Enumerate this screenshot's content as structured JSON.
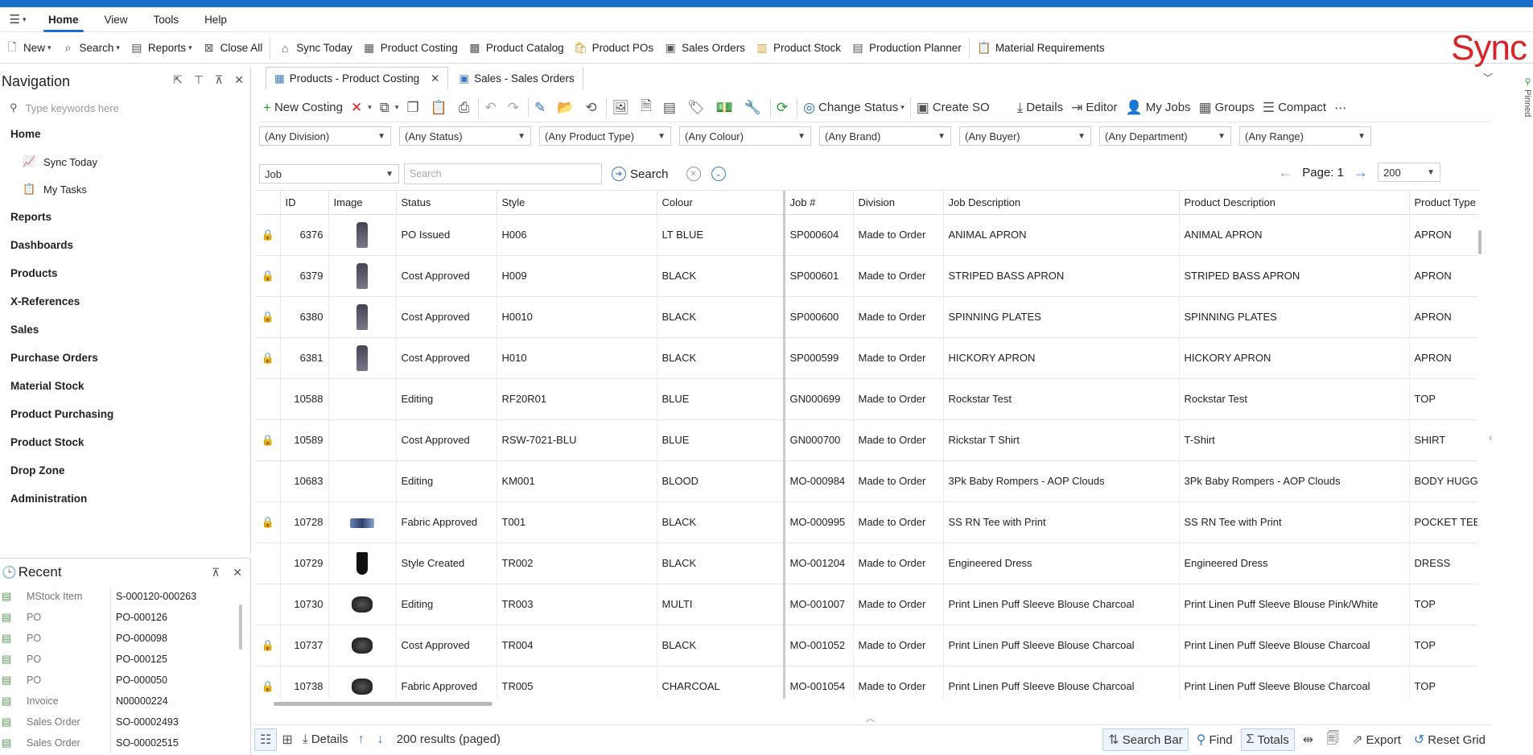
{
  "menubar": {
    "items": [
      "Home",
      "View",
      "Tools",
      "Help"
    ],
    "active": "Home"
  },
  "quickbar": {
    "new": "New",
    "search": "Search",
    "reports": "Reports",
    "close_all": "Close All",
    "sync_today": "Sync Today",
    "product_costing": "Product Costing",
    "product_catalog": "Product Catalog",
    "product_pos": "Product POs",
    "sales_orders": "Sales Orders",
    "product_stock": "Product Stock",
    "production_planner": "Production Planner",
    "material_requirements": "Material Requirements"
  },
  "logo": "Sync",
  "navigation": {
    "title": "Navigation",
    "search_placeholder": "Type keywords here",
    "home": "Home",
    "sync_today": "Sync Today",
    "my_tasks": "My Tasks",
    "sections": [
      "Reports",
      "Dashboards",
      "Products",
      "X-References",
      "Sales",
      "Purchase Orders",
      "Material Stock",
      "Product Purchasing",
      "Product Stock",
      "Drop Zone",
      "Administration"
    ]
  },
  "recent": {
    "title": "Recent",
    "items": [
      {
        "type": "MStock Item",
        "value": "S-000120-000263"
      },
      {
        "type": "PO",
        "value": "PO-000126"
      },
      {
        "type": "PO",
        "value": "PO-000098"
      },
      {
        "type": "PO",
        "value": "PO-000125"
      },
      {
        "type": "PO",
        "value": "PO-000050"
      },
      {
        "type": "Invoice",
        "value": "N00000224"
      },
      {
        "type": "Sales Order",
        "value": "SO-00002493"
      },
      {
        "type": "Sales Order",
        "value": "SO-00002515"
      }
    ]
  },
  "tabs": [
    {
      "label": "Products - Product Costing",
      "active": true
    },
    {
      "label": "Sales - Sales Orders",
      "active": false
    }
  ],
  "pinned": "Pinned",
  "toolbar": {
    "new_costing": "New Costing",
    "change_status": "Change Status",
    "create_so": "Create SO",
    "details": "Details",
    "editor": "Editor",
    "my_jobs": "My Jobs",
    "groups": "Groups",
    "compact": "Compact"
  },
  "filters": [
    "(Any Division)",
    "(Any Status)",
    "(Any Product Type)",
    "(Any Colour)",
    "(Any Brand)",
    "(Any Buyer)",
    "(Any Department)",
    "(Any Range)"
  ],
  "search": {
    "field": "Job",
    "placeholder": "Search",
    "button": "Search"
  },
  "pager": {
    "label": "Page: 1",
    "page_size": "200"
  },
  "grid": {
    "columns": [
      "ID",
      "Image",
      "Status",
      "Style",
      "Colour",
      "Job #",
      "Division",
      "Job Description",
      "Product Description",
      "Product Type"
    ],
    "rows": [
      {
        "locked": true,
        "id": "6376",
        "img": "apron",
        "status": "PO Issued",
        "style": "H006",
        "colour": "LT BLUE",
        "job": "SP000604",
        "division": "Made to Order",
        "job_desc": "ANIMAL APRON",
        "prod_desc": "ANIMAL APRON",
        "type": "APRON"
      },
      {
        "locked": true,
        "id": "6379",
        "img": "apron",
        "status": "Cost Approved",
        "style": "H009",
        "colour": "BLACK",
        "job": "SP000601",
        "division": "Made to Order",
        "job_desc": "STRIPED BASS APRON",
        "prod_desc": "STRIPED BASS APRON",
        "type": "APRON"
      },
      {
        "locked": true,
        "id": "6380",
        "img": "apron",
        "status": "Cost Approved",
        "style": "H0010",
        "colour": "BLACK",
        "job": "SP000600",
        "division": "Made to Order",
        "job_desc": "SPINNING PLATES",
        "prod_desc": "SPINNING PLATES",
        "type": "APRON"
      },
      {
        "locked": true,
        "id": "6381",
        "img": "apron",
        "status": "Cost Approved",
        "style": "H010",
        "colour": "BLACK",
        "job": "SP000599",
        "division": "Made to Order",
        "job_desc": "HICKORY APRON",
        "prod_desc": "HICKORY APRON",
        "type": "APRON"
      },
      {
        "locked": false,
        "id": "10588",
        "img": "",
        "status": "Editing",
        "style": "RF20R01",
        "colour": "BLUE",
        "job": "GN000699",
        "division": "Made to Order",
        "job_desc": "Rockstar Test",
        "prod_desc": "Rockstar Test",
        "type": "TOP"
      },
      {
        "locked": true,
        "id": "10589",
        "img": "",
        "status": "Cost Approved",
        "style": "RSW-7021-BLU",
        "colour": "BLUE",
        "job": "GN000700",
        "division": "Made to Order",
        "job_desc": "Rickstar T Shirt",
        "prod_desc": "T-Shirt",
        "type": "SHIRT"
      },
      {
        "locked": false,
        "id": "10683",
        "img": "",
        "status": "Editing",
        "style": "KM001",
        "colour": "BLOOD",
        "job": "MO-000984",
        "division": "Made to Order",
        "job_desc": "3Pk Baby Rompers - AOP Clouds",
        "prod_desc": "3Pk Baby Rompers - AOP Clouds",
        "type": "BODY HUGGE"
      },
      {
        "locked": true,
        "id": "10728",
        "img": "flat",
        "status": "Fabric Approved",
        "style": "T001",
        "colour": "BLACK",
        "job": "MO-000995",
        "division": "Made to Order",
        "job_desc": "SS RN Tee with Print",
        "prod_desc": "SS RN Tee with Print",
        "type": "POCKET TEE"
      },
      {
        "locked": false,
        "id": "10729",
        "img": "dress",
        "status": "Style Created",
        "style": "TR002",
        "colour": "BLACK",
        "job": "MO-001204",
        "division": "Made to Order",
        "job_desc": "Engineered Dress",
        "prod_desc": "Engineered Dress",
        "type": "DRESS"
      },
      {
        "locked": false,
        "id": "10730",
        "img": "wide",
        "status": "Editing",
        "style": "TR003",
        "colour": "MULTI",
        "job": "MO-001007",
        "division": "Made to Order",
        "job_desc": "Print Linen Puff Sleeve Blouse Charcoal",
        "prod_desc": "Print Linen Puff Sleeve Blouse Pink/White",
        "type": "TOP"
      },
      {
        "locked": true,
        "id": "10737",
        "img": "wide",
        "status": "Cost Approved",
        "style": "TR004",
        "colour": "BLACK",
        "job": "MO-001052",
        "division": "Made to Order",
        "job_desc": "Print Linen Puff Sleeve Blouse Charcoal",
        "prod_desc": "Print Linen Puff Sleeve Blouse Charcoal",
        "type": "TOP"
      },
      {
        "locked": true,
        "id": "10738",
        "img": "wide",
        "status": "Fabric Approved",
        "style": "TR005",
        "colour": "CHARCOAL",
        "job": "MO-001054",
        "division": "Made to Order",
        "job_desc": "Print Linen Puff Sleeve Blouse Charcoal",
        "prod_desc": "Print Linen Puff Sleeve Blouse Charcoal",
        "type": "TOP"
      }
    ]
  },
  "statusbar": {
    "details": "Details",
    "results": "200 results (paged)",
    "search_bar": "Search Bar",
    "find": "Find",
    "totals": "Totals",
    "export": "Export",
    "reset_grid": "Reset Grid"
  }
}
